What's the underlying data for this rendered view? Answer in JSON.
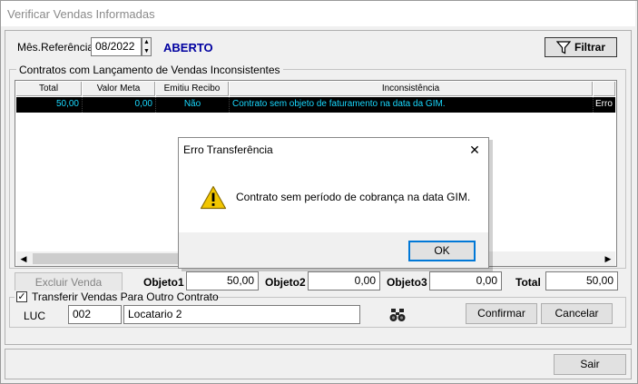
{
  "window": {
    "title": "Verificar Vendas Informadas"
  },
  "header": {
    "mes_label": "Mês.Referência",
    "mes_value": "08/2022",
    "status": "ABERTO",
    "filter_label": "Filtrar"
  },
  "contracts_group": {
    "title": "Contratos com Lançamento de Vendas Inconsistentes",
    "columns": [
      "Total",
      "Valor Meta",
      "Emitiu Recibo",
      "Inconsistência"
    ],
    "rows": [
      {
        "total": "50,00",
        "valor_meta": "0,00",
        "emitiu_recibo": "Não",
        "inconsistencia": "Contrato sem objeto de faturamento na data da GIM.",
        "extra": "Erro"
      }
    ]
  },
  "totals": {
    "excluir_label": "Excluir Venda",
    "objeto1_label": "Objeto1",
    "objeto1_value": "50,00",
    "objeto2_label": "Objeto2",
    "objeto2_value": "0,00",
    "objeto3_label": "Objeto3",
    "objeto3_value": "0,00",
    "total_label": "Total",
    "total_value": "50,00"
  },
  "transfer_group": {
    "checked": true,
    "title": "Transferir Vendas Para Outro Contrato",
    "luc_label": "LUC",
    "luc_value": "002",
    "locatario_value": "Locatario 2",
    "confirm_label": "Confirmar",
    "cancel_label": "Cancelar"
  },
  "footer": {
    "exit_label": "Sair"
  },
  "dialog": {
    "title": "Erro Transferência",
    "message": "Contrato sem período de cobrança na data GIM.",
    "ok_label": "OK",
    "close_glyph": "✕",
    "icon": "warning-icon"
  },
  "colors": {
    "status": "#0000a0",
    "grid_row_bg": "#000000",
    "grid_row_text": "#19d9ff",
    "warning": "#f2c600"
  }
}
